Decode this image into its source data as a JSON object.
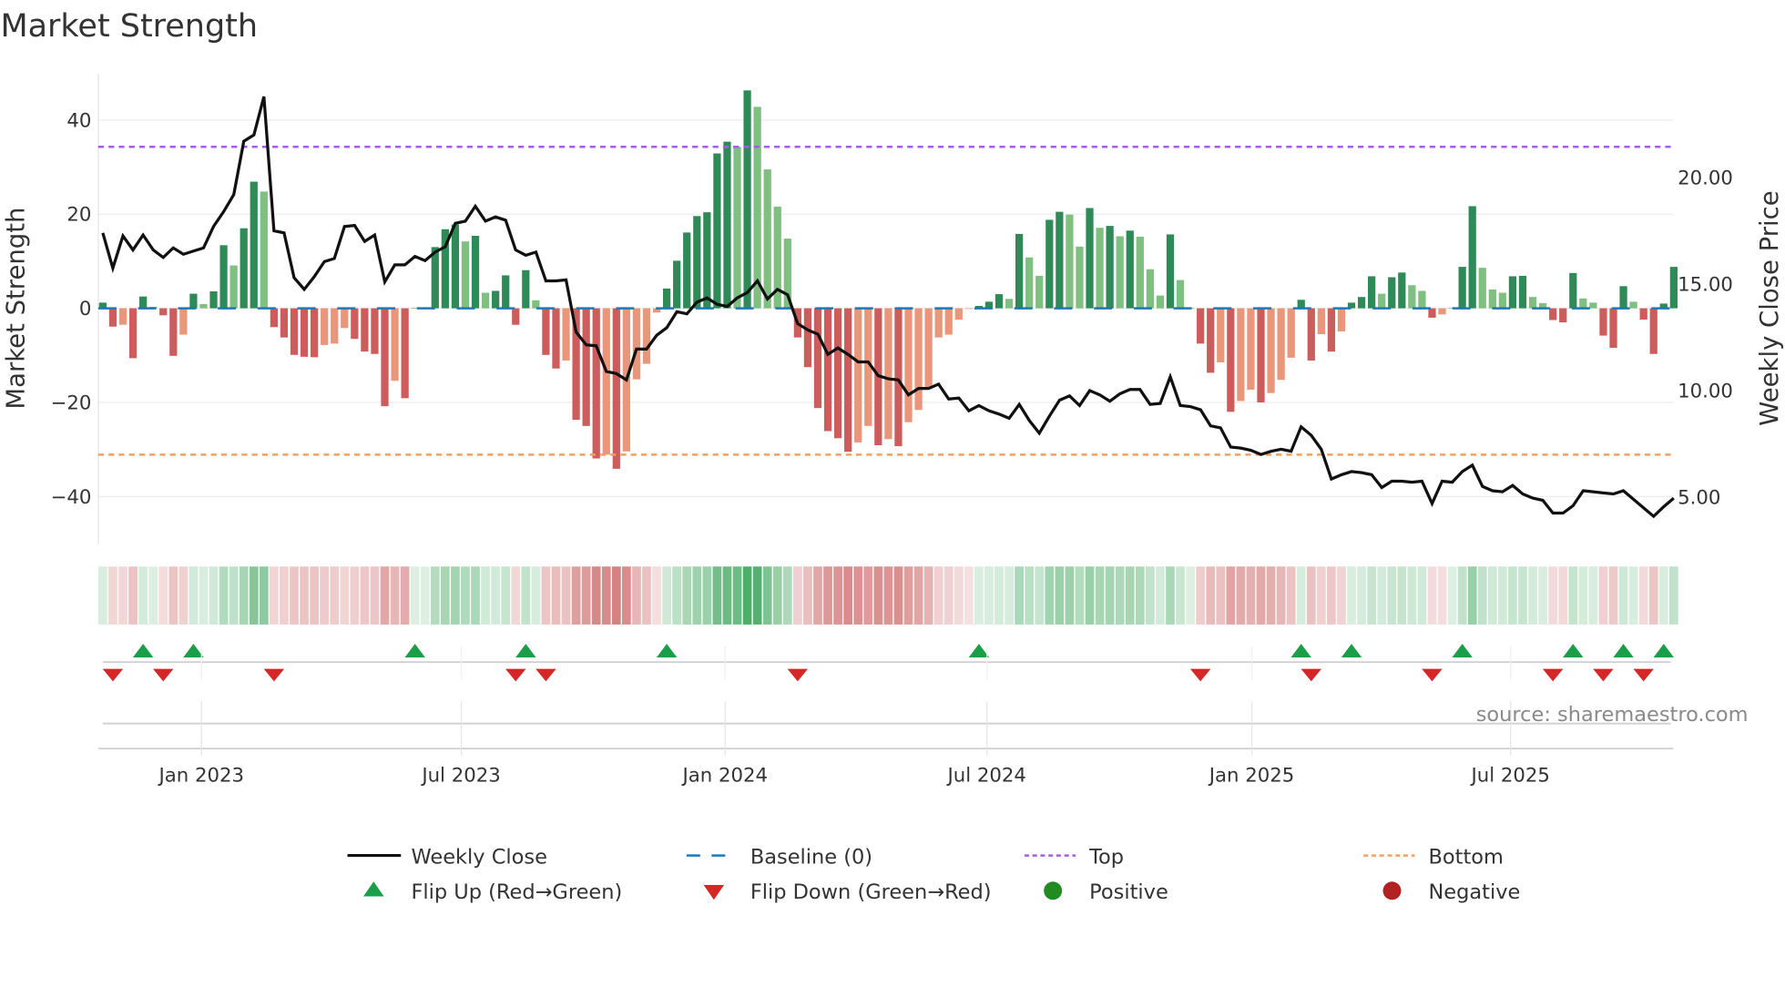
{
  "chart_data": {
    "type": "bar",
    "title": "Market Strength",
    "ylabel": "Market Strength",
    "y2label": "Weekly Close Price",
    "ylim": [
      -50,
      50
    ],
    "y2lim": [
      2.8,
      24.9
    ],
    "yticks": [
      40,
      20,
      0,
      -20,
      -40
    ],
    "ytick_labels": [
      "40",
      "20",
      "0",
      "−20",
      "−40"
    ],
    "y2ticks": [
      20,
      15,
      10,
      5
    ],
    "y2tick_labels": [
      "20.00",
      "15.00",
      "10.00",
      "5.00"
    ],
    "xticks": [
      {
        "label": "Jan 2023",
        "week": 10.8
      },
      {
        "label": "Jul 2023",
        "week": 36.6
      },
      {
        "label": "Jan 2024",
        "week": 62.8
      },
      {
        "label": "Jul 2024",
        "week": 88.8
      },
      {
        "label": "Jan 2025",
        "week": 115.1
      },
      {
        "label": "Jul 2025",
        "week": 140.8
      }
    ],
    "top_level": 34.3,
    "bottom_level": -31.1,
    "strength": [
      1.2,
      -3.9,
      -3.5,
      -10.6,
      2.5,
      0.3,
      -1.5,
      -10.1,
      -5.6,
      3.1,
      0.9,
      3.6,
      13.4,
      9.1,
      17,
      26.9,
      24.8,
      -4,
      -6.2,
      -9.9,
      -10.3,
      -10.4,
      -7.8,
      -7.5,
      -4.2,
      -6.5,
      -9.2,
      -9.7,
      -20.8,
      -15.4,
      -19.1,
      0.1,
      0.1,
      13,
      16.8,
      17.8,
      14.2,
      15.4,
      3.3,
      3.7,
      7,
      -3.5,
      8.1,
      1.7,
      -9.9,
      -12.8,
      -11.1,
      -23.7,
      -25,
      -31.9,
      -31.1,
      -34.1,
      -30.4,
      -15.1,
      -11.8,
      -0.9,
      4.2,
      10.1,
      16.1,
      19.6,
      20.4,
      32.9,
      35.4,
      34.3,
      46.3,
      42.8,
      29.5,
      21.6,
      14.8,
      -6.2,
      -12.5,
      -21.2,
      -26.1,
      -27.6,
      -30.5,
      -28.5,
      -25,
      -29.1,
      -27.8,
      -29.3,
      -24.2,
      -21.6,
      -16.7,
      -6.2,
      -5.6,
      -2.4,
      -0.1,
      0.5,
      1.4,
      3,
      2,
      15.8,
      10.8,
      6.9,
      18.8,
      20.5,
      19.9,
      13.1,
      21.3,
      17.1,
      17.5,
      15.3,
      16.5,
      15.2,
      8.3,
      2.7,
      15.7,
      6,
      0.1,
      -7.5,
      -13.7,
      -11.5,
      -22,
      -19.7,
      -17.3,
      -20,
      -18,
      -15.2,
      -10.5,
      1.8,
      -11.1,
      -5.5,
      -9.2,
      -4.9,
      1.2,
      2.4,
      6.8,
      3.1,
      6.6,
      7.6,
      4.9,
      3.7,
      -2,
      -1.3,
      0.1,
      8.8,
      21.7,
      8.6,
      4,
      3.3,
      6.8,
      6.9,
      2.4,
      1.1,
      -2.5,
      -3,
      7.5,
      2.1,
      1.2,
      -5.8,
      -8.4,
      4.7,
      1.4,
      -2.4,
      -9.7,
      1,
      8.8
    ],
    "strong": [
      1,
      1,
      0,
      1,
      1,
      0,
      1,
      1,
      0,
      1,
      0,
      1,
      1,
      0,
      1,
      1,
      0,
      1,
      1,
      1,
      1,
      1,
      0,
      0,
      0,
      1,
      1,
      1,
      1,
      0,
      1,
      0,
      0,
      1,
      1,
      1,
      0,
      1,
      0,
      1,
      1,
      1,
      1,
      0,
      1,
      1,
      0,
      1,
      1,
      1,
      0,
      1,
      0,
      0,
      0,
      0,
      1,
      1,
      1,
      1,
      1,
      1,
      1,
      0,
      1,
      0,
      0,
      0,
      0,
      1,
      1,
      1,
      1,
      1,
      1,
      0,
      0,
      1,
      0,
      1,
      0,
      0,
      0,
      0,
      0,
      0,
      0,
      1,
      1,
      1,
      0,
      1,
      0,
      0,
      1,
      1,
      0,
      0,
      1,
      0,
      1,
      0,
      1,
      0,
      0,
      0,
      1,
      0,
      0,
      1,
      1,
      0,
      1,
      0,
      0,
      1,
      0,
      0,
      0,
      1,
      1,
      0,
      1,
      0,
      1,
      1,
      1,
      0,
      1,
      1,
      0,
      0,
      1,
      0,
      0,
      1,
      1,
      0,
      0,
      0,
      1,
      1,
      0,
      0,
      1,
      1,
      1,
      0,
      0,
      1,
      1,
      1,
      0,
      1,
      1,
      1,
      1
    ],
    "weekly_close": [
      17.4,
      15.75,
      17.26,
      16.6,
      17.3,
      16.6,
      16.25,
      16.7,
      16.4,
      16.55,
      16.7,
      17.7,
      18.4,
      19.2,
      21.7,
      22.0,
      23.8,
      17.5,
      17.4,
      15.3,
      14.75,
      15.35,
      16.05,
      16.2,
      17.7,
      17.75,
      17.0,
      17.3,
      15.1,
      15.9,
      15.9,
      16.3,
      16.1,
      16.5,
      16.75,
      17.85,
      17.95,
      18.65,
      17.95,
      18.15,
      18.0,
      16.6,
      16.35,
      16.5,
      15.15,
      15.15,
      15.2,
      12.75,
      12.15,
      12.1,
      10.9,
      10.8,
      10.5,
      11.95,
      11.95,
      12.6,
      12.95,
      13.7,
      13.6,
      14.15,
      14.35,
      14.05,
      13.95,
      14.35,
      14.6,
      15.15,
      14.3,
      14.75,
      14.5,
      13.15,
      12.85,
      12.65,
      11.7,
      12.0,
      11.7,
      11.35,
      11.35,
      10.7,
      10.55,
      10.5,
      9.8,
      10.1,
      10.1,
      10.3,
      9.6,
      9.65,
      9.05,
      9.3,
      9.05,
      8.9,
      8.7,
      9.35,
      8.6,
      8.0,
      8.8,
      9.55,
      9.75,
      9.3,
      10.0,
      9.8,
      9.5,
      9.85,
      10.05,
      10.05,
      9.35,
      9.4,
      10.65,
      9.3,
      9.25,
      9.1,
      8.35,
      8.25,
      7.35,
      7.3,
      7.2,
      7.0,
      7.15,
      7.25,
      7.15,
      8.3,
      7.9,
      7.25,
      5.85,
      6.05,
      6.2,
      6.15,
      6.05,
      5.45,
      5.75,
      5.75,
      5.7,
      5.75,
      4.7,
      5.75,
      5.7,
      6.2,
      6.5,
      5.5,
      5.3,
      5.25,
      5.55,
      5.15,
      4.95,
      4.85,
      4.25,
      4.25,
      4.6,
      5.3,
      5.25,
      5.2,
      5.15,
      5.3,
      4.9,
      4.5,
      4.1,
      4.55,
      4.95
    ],
    "flip_up_weeks": [
      5,
      10,
      32,
      43,
      57,
      88,
      120,
      125,
      136,
      147,
      152,
      156
    ],
    "flip_down_weeks": [
      2,
      7,
      18,
      42,
      45,
      70,
      110,
      121,
      133,
      145,
      150,
      154
    ],
    "colors": {
      "positive_strong": "#2e8b57",
      "positive_weak": "#7fbf7f",
      "negative_strong": "#cd5c5c",
      "negative_weak": "#e9967a",
      "baseline": "#1f77b4",
      "top": "#a35ee6",
      "bottom": "#f0a060",
      "close": "#111111",
      "flip_up": "#1a9e47",
      "flip_down": "#d62728",
      "positive_dot": "#228b22",
      "negative_dot": "#b22222"
    },
    "legend": {
      "weekly_close": "Weekly Close",
      "baseline": "Baseline (0)",
      "top": "Top",
      "bottom": "Bottom",
      "flip_up": "Flip Up (Red→Green)",
      "flip_down": "Flip Down (Green→Red)",
      "positive": "Positive",
      "negative": "Negative"
    },
    "legend_placement": "bottom-center",
    "source": "source: sharemaestro.com"
  }
}
